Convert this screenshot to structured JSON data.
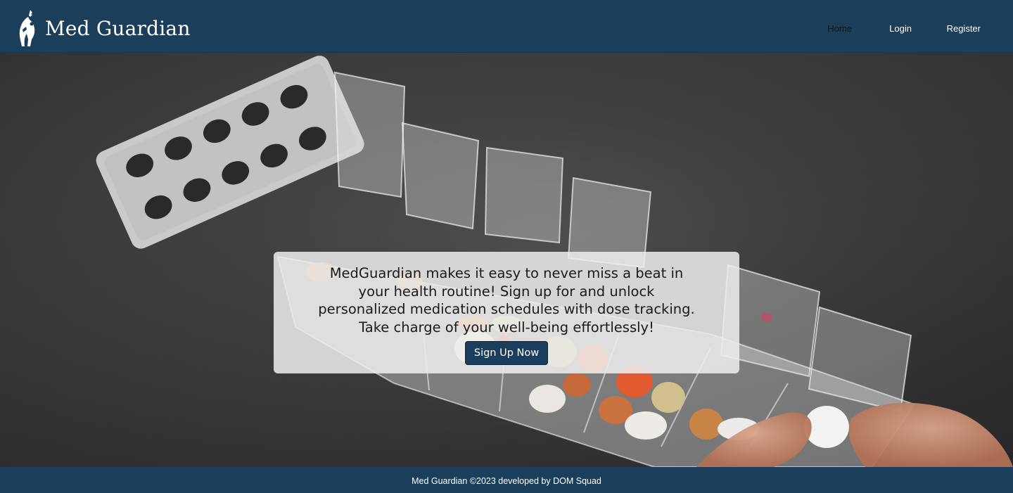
{
  "brand": {
    "name": "Med Guardian",
    "logo_icon": "guardian-figure-icon"
  },
  "nav": {
    "home": "Home",
    "login": "Login",
    "register": "Register",
    "active": "Home"
  },
  "hero": {
    "background": "pill-organizer-photo",
    "message": "MedGuardian makes it easy to never miss a beat in your health routine! Sign up for and unlock personalized medication schedules with dose tracking. Take charge of your well-being effortlessly!",
    "cta_label": "Sign Up Now"
  },
  "footer": {
    "text": "Med Guardian ©2023 developed by DOM Squad"
  },
  "colors": {
    "navbar": "#1b3f5a",
    "button": "#1a3e5c",
    "active_link": "#0b1620"
  }
}
